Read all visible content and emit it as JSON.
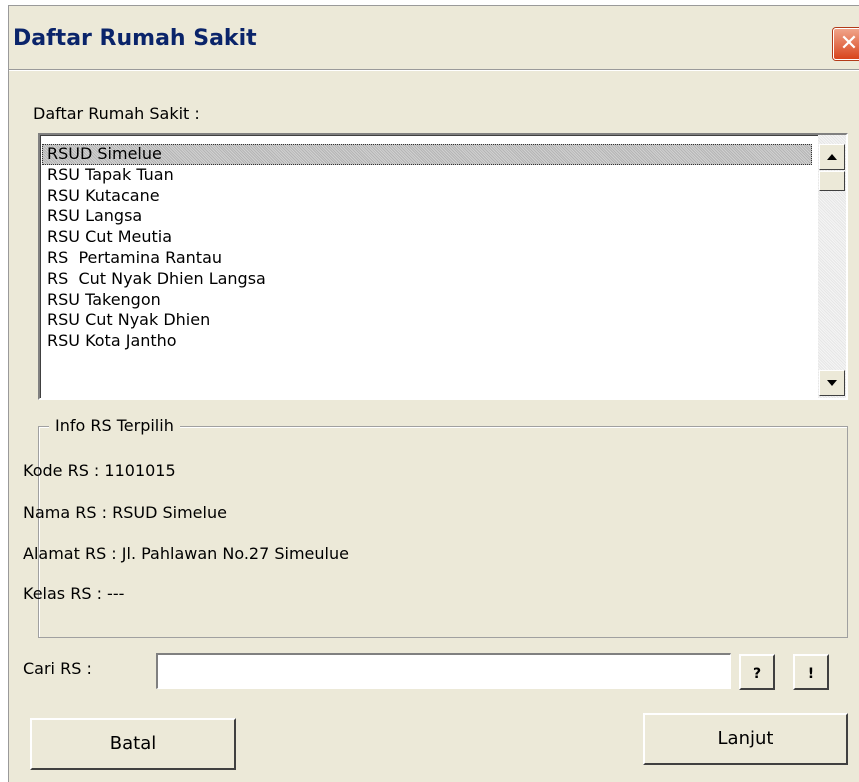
{
  "window": {
    "title": "Daftar Rumah Sakit",
    "close_symbol": "✕"
  },
  "list": {
    "label": "Daftar Rumah Sakit :",
    "items": [
      "RSUD Simelue",
      "RSU Tapak Tuan",
      "RSU Kutacane",
      "RSU Langsa",
      "RSU Cut Meutia",
      "RS  Pertamina Rantau",
      "RS  Cut Nyak Dhien Langsa",
      "RSU Takengon",
      "RSU Cut Nyak Dhien",
      "RSU Kota Jantho"
    ],
    "selected_index": 0
  },
  "info": {
    "group_title": "Info RS Terpilih",
    "kode": "Kode RS : 1101015",
    "nama": "Nama RS : RSUD Simelue",
    "alamat": "Alamat RS : Jl. Pahlawan No.27 Simeulue",
    "kelas": "Kelas RS : ---"
  },
  "search": {
    "label": "Cari RS :",
    "value": "",
    "help_button": "?",
    "go_button": "!"
  },
  "buttons": {
    "cancel": "Batal",
    "next": "Lanjut"
  },
  "icons": {
    "scroll_up": "up-arrow-icon",
    "scroll_down": "down-arrow-icon",
    "close": "close-icon"
  }
}
